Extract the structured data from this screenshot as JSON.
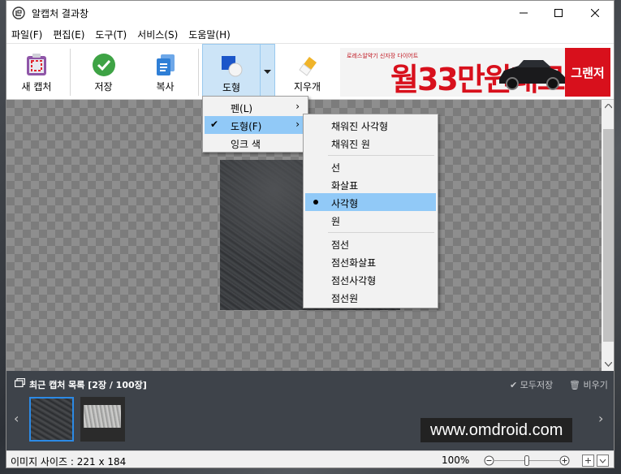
{
  "window": {
    "title": "알캡처 결과창"
  },
  "menubar": [
    "파일(F)",
    "편집(E)",
    "도구(T)",
    "서비스(S)",
    "도움말(H)"
  ],
  "toolbar": {
    "new_capture": "새 캡처",
    "save": "저장",
    "copy": "복사",
    "shape": "도형",
    "eraser": "지우개"
  },
  "ad": {
    "small_text": "로레스알약기 신자장 다이어트",
    "headline": "월33만원대로",
    "tag": "그랜저"
  },
  "context_menu": {
    "items": [
      {
        "label": "펜(L)",
        "has_submenu": true,
        "checked": false
      },
      {
        "label": "도형(F)",
        "has_submenu": true,
        "checked": true
      },
      {
        "label": "잉크 색",
        "has_submenu": false,
        "checked": false
      }
    ]
  },
  "shape_submenu": {
    "groups": [
      [
        "채워진 사각형",
        "채워진 원"
      ],
      [
        "선",
        "화살표",
        "사각형",
        "원"
      ],
      [
        "점선",
        "점선화살표",
        "점선사각형",
        "점선원"
      ]
    ],
    "selected": "사각형"
  },
  "recent": {
    "title": "최근 캡처 목록 [2장 / 100장]",
    "save_all": "모두저장",
    "clear": "비우기",
    "count": 2,
    "capacity": 100
  },
  "watermark": "www.omdroid.com",
  "status": {
    "image_size": "이미지 사이즈 : 221 x 184",
    "zoom": "100%",
    "zoom_fraction": 0.5
  },
  "colors": {
    "accent": "#2b8ae6",
    "menu_highlight": "#91c9f7",
    "panel_bg": "#3e434a",
    "ad_red": "#d8101c"
  }
}
